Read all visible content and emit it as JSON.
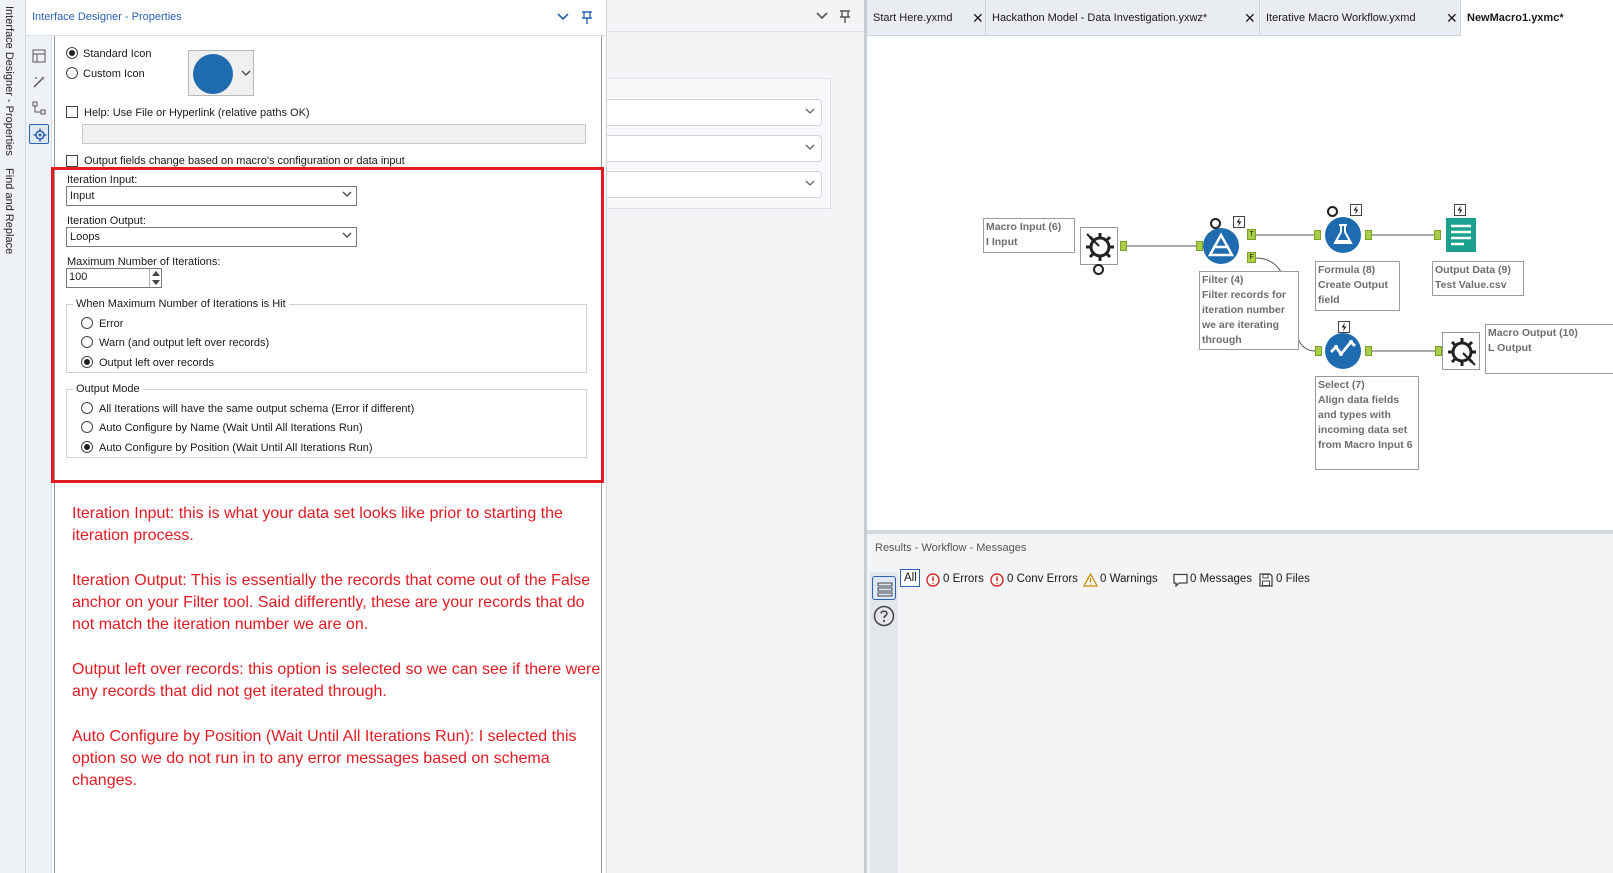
{
  "side_strip": {
    "labels": [
      "Interface Designer - Properties",
      "Find and Replace"
    ]
  },
  "properties_panel": {
    "title": "Interface Designer - Properties",
    "icon_options": [
      "Standard Icon",
      "Custom Icon"
    ],
    "icon_selected": "Standard Icon",
    "icon_color": "#1f6bb0",
    "help_label": "Help: Use File or Hyperlink (relative paths OK)",
    "help_value": "",
    "output_fields_label": "Output fields change based on macro's configuration or data input",
    "iteration_input_label": "Iteration Input:",
    "iteration_input_value": "Input",
    "iteration_output_label": "Iteration Output:",
    "iteration_output_value": "Loops",
    "max_iterations_label": "Maximum Number of Iterations:",
    "max_iterations_value": "100",
    "max_hit_group": {
      "title": "When Maximum Number of Iterations is Hit",
      "options": [
        "Error",
        "Warn (and output left over records)",
        "Output left over records"
      ],
      "selected": "Output left over records"
    },
    "output_mode_group": {
      "title": "Output Mode",
      "options": [
        "All Iterations will have the same output schema (Error if different)",
        "Auto Configure by Name (Wait Until All Iterations Run)",
        "Auto Configure by Position (Wait Until All Iterations Run)"
      ],
      "selected": "Auto Configure by Position (Wait Until All Iterations Run)"
    }
  },
  "annotations": [
    "Iteration Input: this is what your data set looks like prior to starting the iteration process.",
    "Iteration Output: This is essentially the records that come out of the False anchor on your Filter tool. Said differently, these are your records that do not match the iteration number we are on.",
    "Output left over records: this option is selected so we can see if there were any records that did not get iterated through.",
    "Auto Configure by Position (Wait Until All Iterations Run): I selected this option so we do not run in to any error messages based on schema changes."
  ],
  "tabs": [
    {
      "label": "Start Here.yxmd",
      "active": false
    },
    {
      "label": "Hackathon Model - Data Investigation.yxwz*",
      "active": false
    },
    {
      "label": "Iterative Macro Workflow.yxmd",
      "active": false
    },
    {
      "label": "NewMacro1.yxmc*",
      "active": true
    }
  ],
  "workflow_nodes": {
    "macro_input": {
      "line1": "Macro Input (6)",
      "line2": "I Input"
    },
    "filter": {
      "line1": "Filter (4)",
      "line2": "Filter records for iteration number we are iterating through",
      "anchor_true": "T",
      "anchor_false": "F"
    },
    "formula": {
      "line1": "Formula (8)",
      "line2": "Create Output field"
    },
    "output_data": {
      "line1": "Output Data (9)",
      "line2": "Test Value.csv"
    },
    "select": {
      "line1": "Select (7)",
      "line2": "Align data fields and types with incoming data set from Macro Input 6"
    },
    "macro_output": {
      "line1": "Macro Output (10)",
      "line2": "L Output"
    }
  },
  "results": {
    "title": "Results - Workflow - Messages",
    "filter_all": "All",
    "errors": "0 Errors",
    "conv_errors": "0 Conv Errors",
    "warnings": "0 Warnings",
    "messages": "0 Messages",
    "files": "0 Files"
  },
  "colors": {
    "accent": "#2b62b3",
    "annotation_red": "#e31b23",
    "anchor_green": "#a8cf45",
    "tool_blue": "#1f6bb0",
    "output_teal": "#1aa08c"
  }
}
